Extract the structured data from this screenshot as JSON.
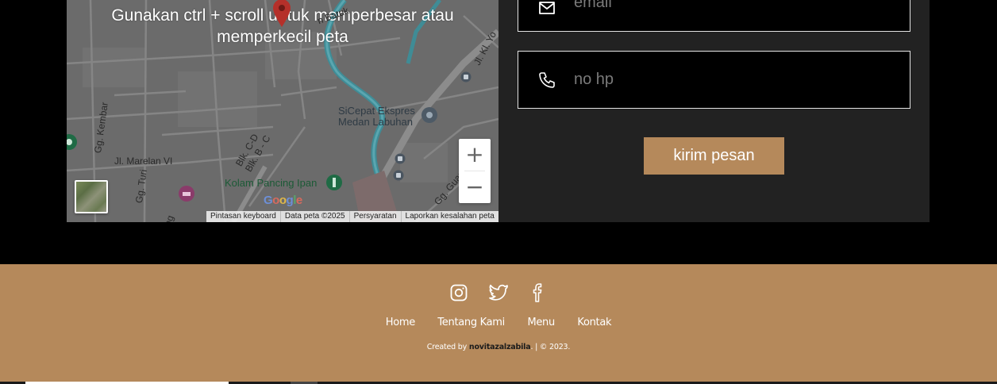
{
  "map": {
    "overlay_line1": "Gunakan ctrl + scroll untuk memperbesar atau",
    "overlay_line2": "memperkecil peta",
    "labels": {
      "marelan": "Jl. Marelan VI",
      "kembar": "Gg. Kembar",
      "turi": "Gg. Turi",
      "blk_cd": "Blk. C-D",
      "blk_bc": "Blk. B - C",
      "sicepat_1": "SiCepat Ekspres",
      "sicepat_2": "Medan Labuhan",
      "kolam": "Kolam Pancing Ipan",
      "guan": "Gg. Guan",
      "kl_yos": "Jl. Kl. Yo",
      "ily": "ily",
      "ng": "ng",
      "pt_satuk": "n Batuk"
    },
    "google_letters": [
      "G",
      "o",
      "o",
      "g",
      "l",
      "e"
    ],
    "footer": {
      "shortcuts": "Pintasan keyboard",
      "data": "Data peta ©2025",
      "terms": "Persyaratan",
      "report": "Laporkan kesalahan peta"
    },
    "zoom_in": "+",
    "zoom_out": "−"
  },
  "form": {
    "email_placeholder": "email",
    "phone_placeholder": "no hp",
    "submit_label": "kirim pesan"
  },
  "footer": {
    "social_icons": [
      "instagram-icon",
      "twitter-icon",
      "facebook-icon"
    ],
    "nav": {
      "home": "Home",
      "about": "Tentang Kami",
      "menu": "Menu",
      "contact": "Kontak"
    },
    "credits_prefix": "Created by ",
    "credits_author": "novitazalzabila",
    "credits_suffix": ". | © 2023."
  },
  "colors": {
    "accent": "#b5895b",
    "panel": "#222222",
    "background": "#000000"
  }
}
